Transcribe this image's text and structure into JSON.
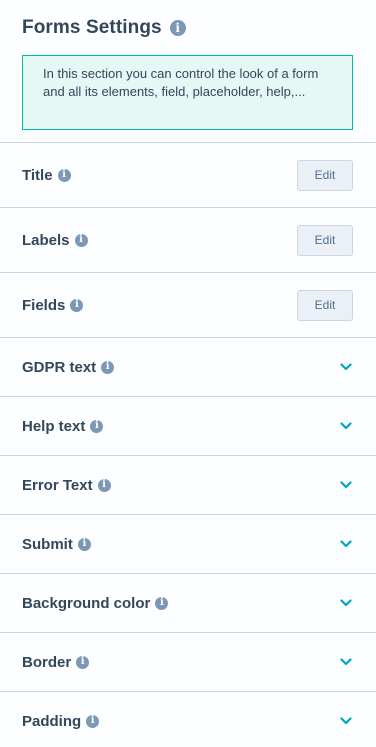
{
  "panel": {
    "title": "Forms Settings",
    "info_glyph": "i",
    "notice": "In this section you can control the look of a form and all its elements, field, placeholder, help,..."
  },
  "edit_rows": [
    {
      "label": "Title",
      "button": "Edit"
    },
    {
      "label": "Labels",
      "button": "Edit"
    },
    {
      "label": "Fields",
      "button": "Edit"
    }
  ],
  "collapsible_rows": [
    {
      "label": "GDPR text",
      "icon": "chevron-down-icon"
    },
    {
      "label": "Help text",
      "icon": "chevron-down-icon"
    },
    {
      "label": "Error Text",
      "icon": "chevron-down-icon"
    },
    {
      "label": "Submit",
      "icon": "chevron-down-icon"
    },
    {
      "label": "Background color",
      "icon": "chevron-down-icon"
    },
    {
      "label": "Border",
      "icon": "chevron-down-icon"
    },
    {
      "label": "Padding",
      "icon": "chevron-down-icon"
    }
  ],
  "colors": {
    "text": "#33475b",
    "info_icon": "#7c98b6",
    "notice_bg": "#e5f8f6",
    "notice_border": "#00bda5",
    "chevron": "#00a4bd",
    "button_bg": "#eaf0f6",
    "divider": "#cbd6e2"
  }
}
